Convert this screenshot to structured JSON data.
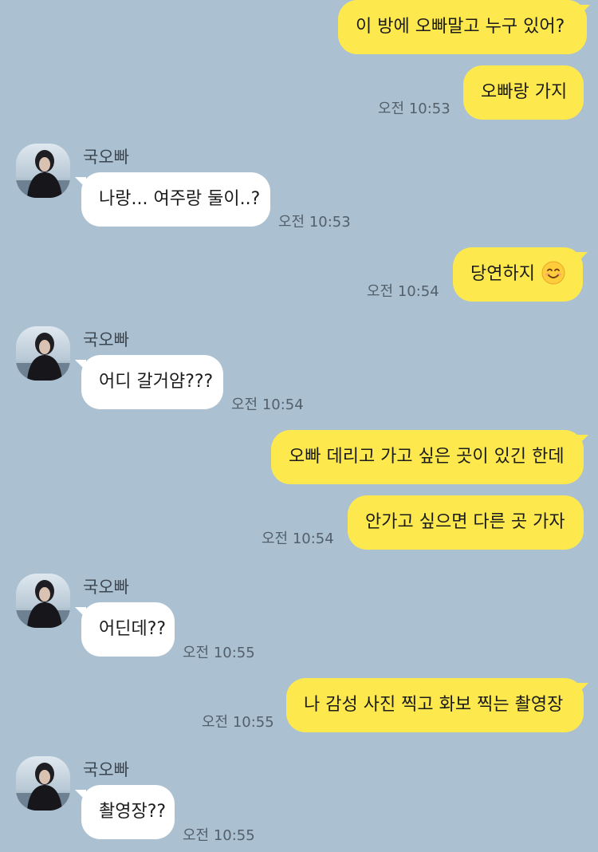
{
  "contact": {
    "name": "국오빠",
    "avatar_icon": "profile-photo"
  },
  "colors": {
    "background": "#abc1d1",
    "my_bubble": "#fde94e",
    "their_bubble": "#ffffff"
  },
  "messages": [
    {
      "sender": "me",
      "text": "이 방에 오빠말고 누구 있어?",
      "time": ""
    },
    {
      "sender": "me",
      "text": "오빠랑 가지",
      "time": "오전 10:53"
    },
    {
      "sender": "them",
      "text": "나랑... 여주랑 둘이..?",
      "time": "오전 10:53"
    },
    {
      "sender": "me",
      "text": "당연하지",
      "emoji": "smiling-face-emoji",
      "time": "오전 10:54"
    },
    {
      "sender": "them",
      "text": "어디 갈거얌???",
      "time": "오전 10:54"
    },
    {
      "sender": "me",
      "text": "오빠 데리고 가고 싶은 곳이 있긴 한데",
      "time": ""
    },
    {
      "sender": "me",
      "text": "안가고 싶으면 다른 곳 가자",
      "time": "오전 10:54"
    },
    {
      "sender": "them",
      "text": "어딘데??",
      "time": "오전 10:55"
    },
    {
      "sender": "me",
      "text": "나 감성 사진 찍고 화보 찍는 촬영장",
      "time": "오전 10:55"
    },
    {
      "sender": "them",
      "text": "촬영장??",
      "time": "오전 10:55"
    }
  ]
}
